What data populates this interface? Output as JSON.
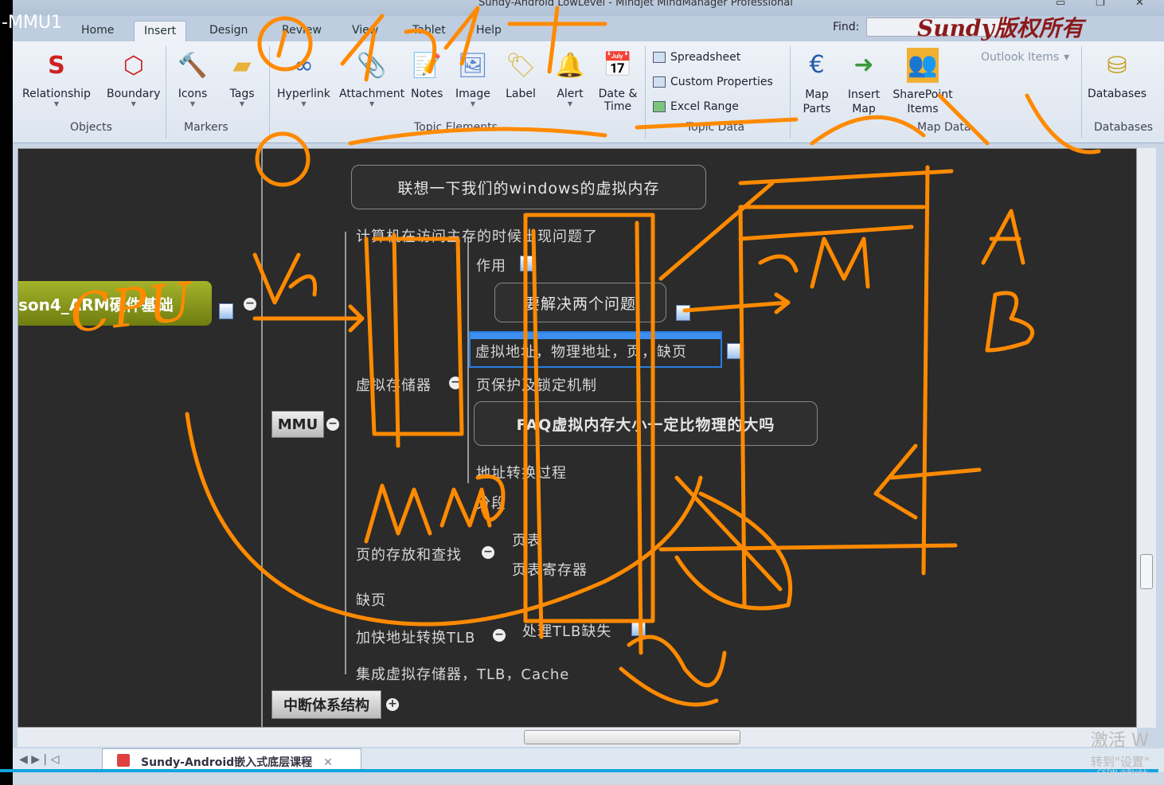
{
  "window": {
    "title": "Sundy-Android LowLevel - Mindjet MindManager Professional",
    "overlay_label": "-MMU1",
    "watermark": "Sundy版权所有",
    "find_label": "Find:",
    "find_value": ""
  },
  "ribbon_tabs": [
    "Home",
    "Insert",
    "Design",
    "Review",
    "View",
    "Tablet",
    "Help"
  ],
  "active_tab": "Insert",
  "ribbon": {
    "objects": {
      "items": [
        "Relationship",
        "Boundary"
      ],
      "group": "Objects"
    },
    "markers": {
      "items": [
        "Icons",
        "Tags"
      ],
      "group": "Markers"
    },
    "topic_elements": {
      "items": [
        "Hyperlink",
        "Attachment",
        "Notes",
        "Image",
        "Label",
        "Alert",
        "Date & Time"
      ],
      "group": "Topic Elements"
    },
    "topic_data": {
      "items": [
        "Spreadsheet",
        "Custom Properties",
        "Excel Range"
      ],
      "group": "Topic Data"
    },
    "map_data": {
      "items": [
        "Map Parts",
        "Insert Map",
        "SharePoint Items",
        "Outlook Items"
      ],
      "group": "Map Data"
    },
    "databases": {
      "items": [
        "Databases"
      ],
      "group": "Databases"
    }
  },
  "map": {
    "central": "son4_ARM硬件基础",
    "mmu": "MMU",
    "interrupt": "中断体系结构",
    "callout_windows": "联想一下我们的windows的虚拟内存",
    "branch1": "计算机在访问主存的时候出现问题了",
    "zuoyong": "作用",
    "callout_two": "要解决两个问题",
    "selected": "虚拟地址，物理地址，页，缺页",
    "branch2": "虚拟存储器",
    "page_protect": "页保护及锁定机制",
    "callout_faq": "FAQ虚拟内存大小一定比物理的大吗",
    "addr_trans": "地址转换过程",
    "segment": "分段",
    "branch3": "页的存放和查找",
    "page_table": "页表",
    "page_table_reg": "页表寄存器",
    "branch4": "缺页",
    "branch5": "加快地址转换TLB",
    "tlb_miss": "处理TLB缺失",
    "branch6": "集成虚拟存储器，TLB，Cache"
  },
  "doc_tab": "Sundy-Android嵌入式底层课程",
  "os_overlay": {
    "activate": "激活 W",
    "settings": "转到\"设置\"",
    "credit": "CSDN @Btobk"
  },
  "annotations": {
    "color": "#ff8a00",
    "text": [
      "①",
      "②",
      "VA",
      "PM",
      "CPU",
      "MMU",
      "A",
      "B"
    ]
  }
}
